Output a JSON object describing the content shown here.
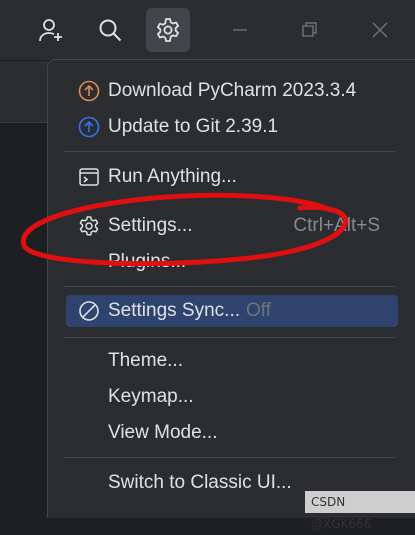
{
  "toolbar": {
    "icons": [
      "add-user-icon",
      "search-icon",
      "gear-icon",
      "minimize-icon",
      "restore-icon",
      "close-icon"
    ]
  },
  "menu": {
    "download_pycharm": "Download PyCharm 2023.3.4",
    "update_git": "Update to Git 2.39.1",
    "run_anything": "Run Anything...",
    "settings": "Settings...",
    "settings_shortcut": "Ctrl+Alt+S",
    "plugins": "Plugins...",
    "settings_sync": "Settings Sync...",
    "settings_sync_state": "Off",
    "theme": "Theme...",
    "keymap": "Keymap...",
    "view_mode": "View Mode...",
    "switch_classic": "Switch to Classic UI..."
  },
  "colors": {
    "accent_orange": "#e08855",
    "accent_blue": "#3574f0",
    "selection": "#2e436e",
    "annotation_red": "#e01010"
  },
  "watermark": "CSDN @XGK666"
}
